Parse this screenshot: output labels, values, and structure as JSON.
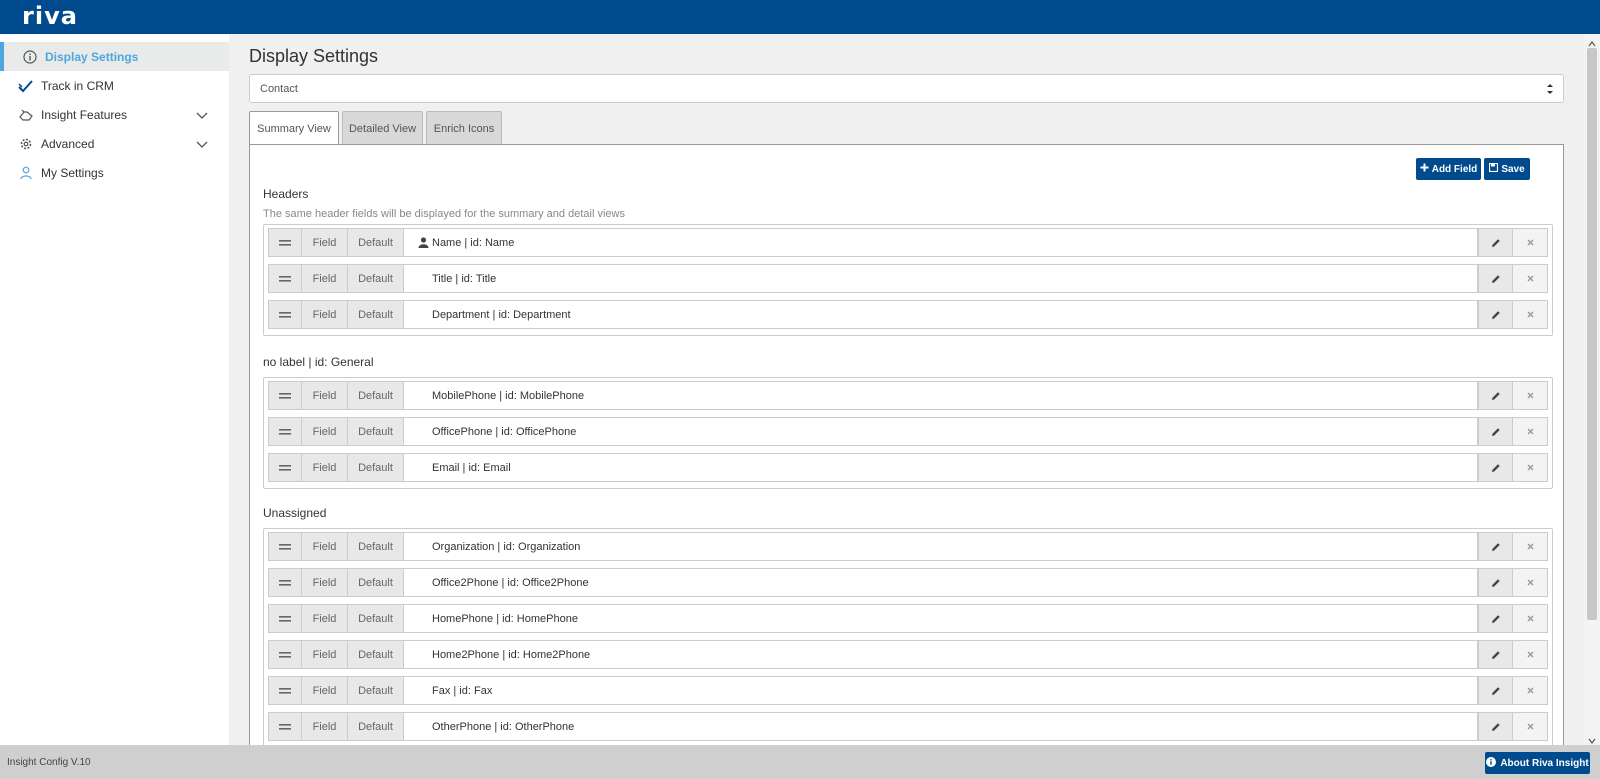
{
  "app": {
    "logo": "riva"
  },
  "sidebar": {
    "items": [
      {
        "label": "Display Settings",
        "icon": "info-circle-icon",
        "active": true
      },
      {
        "label": "Track in CRM",
        "icon": "check-double-icon"
      },
      {
        "label": "Insight Features",
        "icon": "hand-icon",
        "expandable": true
      },
      {
        "label": "Advanced",
        "icon": "gear-icon",
        "expandable": true
      },
      {
        "label": "My Settings",
        "icon": "user-icon"
      }
    ]
  },
  "main": {
    "title": "Display Settings",
    "entity_select": {
      "value": "Contact"
    },
    "tabs": [
      {
        "label": "Summary View",
        "active": true
      },
      {
        "label": "Detailed View"
      },
      {
        "label": "Enrich Icons"
      }
    ],
    "actions": {
      "add_field": "Add Field",
      "save": "Save"
    },
    "cell_labels": {
      "field": "Field",
      "default": "Default"
    },
    "sections": [
      {
        "title": "Headers",
        "note": "The same header fields will be displayed for the summary and detail views",
        "rows": [
          {
            "label": "Name | id: Name",
            "icon": "person-icon"
          },
          {
            "label": "Title | id: Title"
          },
          {
            "label": "Department | id: Department"
          }
        ]
      },
      {
        "title": "no label | id: General",
        "rows": [
          {
            "label": "MobilePhone | id: MobilePhone"
          },
          {
            "label": "OfficePhone | id: OfficePhone"
          },
          {
            "label": "Email | id: Email"
          }
        ]
      },
      {
        "title": "Unassigned",
        "rows": [
          {
            "label": "Organization | id: Organization"
          },
          {
            "label": "Office2Phone | id: Office2Phone"
          },
          {
            "label": "HomePhone | id: HomePhone"
          },
          {
            "label": "Home2Phone | id: Home2Phone"
          },
          {
            "label": "Fax | id: Fax"
          },
          {
            "label": "OtherPhone | id: OtherPhone"
          }
        ]
      }
    ]
  },
  "footer": {
    "version": "Insight Config V.10",
    "about_button": "About Riva Insight"
  },
  "colors": {
    "brand": "#004b8d",
    "accent": "#4ea7dc",
    "footer": "#cfcfcf"
  }
}
